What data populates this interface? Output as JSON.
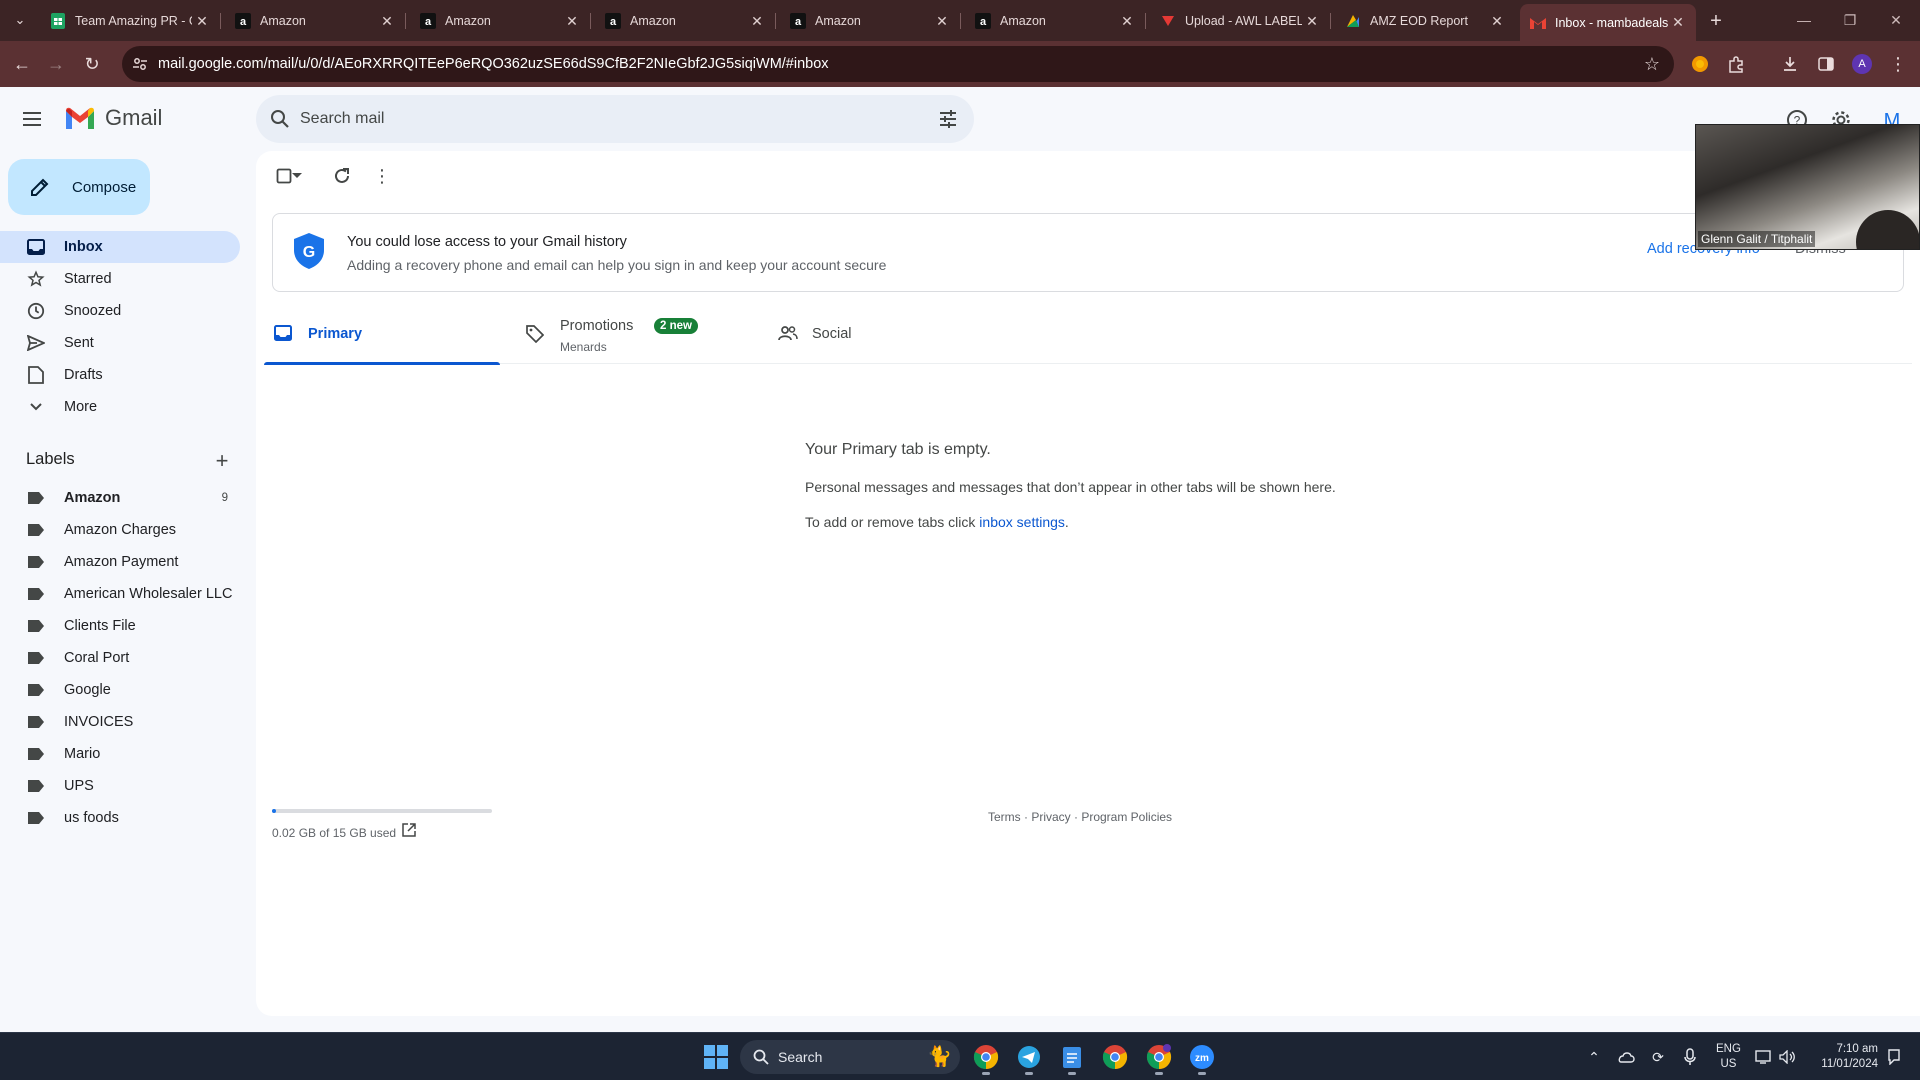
{
  "browser": {
    "tabs": [
      {
        "title": "Team Amazing PR - G",
        "favicon": "sheets-icon"
      },
      {
        "title": "Amazon",
        "favicon": "amazon-icon"
      },
      {
        "title": "Amazon",
        "favicon": "amazon-icon"
      },
      {
        "title": "Amazon",
        "favicon": "amazon-icon"
      },
      {
        "title": "Amazon",
        "favicon": "amazon-icon"
      },
      {
        "title": "Amazon",
        "favicon": "amazon-icon"
      },
      {
        "title": "Upload - AWL LABEL",
        "favicon": "upload-icon"
      },
      {
        "title": "AMZ EOD Report",
        "favicon": "report-icon"
      },
      {
        "title": "Inbox - mambadeals",
        "favicon": "gmail-icon"
      }
    ],
    "url": "mail.google.com/mail/u/0/d/AEoRXRRQITEeP6eRQO362uzSE66dS9CfB2F2NIeGbf2JG5siqiWM/#inbox",
    "profile_initial": "A"
  },
  "gmail": {
    "brand": "Gmail",
    "search_placeholder": "Search mail",
    "avatar_initial": "M",
    "compose_label": "Compose",
    "nav": [
      {
        "label": "Inbox",
        "icon": "inbox-icon",
        "active": true
      },
      {
        "label": "Starred",
        "icon": "star-icon"
      },
      {
        "label": "Snoozed",
        "icon": "clock-icon"
      },
      {
        "label": "Sent",
        "icon": "send-icon"
      },
      {
        "label": "Drafts",
        "icon": "draft-icon"
      },
      {
        "label": "More",
        "icon": "chevron-down-icon"
      }
    ],
    "labels_title": "Labels",
    "labels": [
      {
        "name": "Amazon",
        "count": "9",
        "bold": true
      },
      {
        "name": "Amazon Charges"
      },
      {
        "name": "Amazon Payment"
      },
      {
        "name": "American Wholesaler LLC"
      },
      {
        "name": "Clients File"
      },
      {
        "name": "Coral Port"
      },
      {
        "name": "Google"
      },
      {
        "name": "INVOICES"
      },
      {
        "name": "Mario"
      },
      {
        "name": "UPS"
      },
      {
        "name": "us foods"
      }
    ],
    "banner": {
      "title": "You could lose access to your Gmail history",
      "subtitle": "Adding a recovery phone and email can help you sign in and keep your account secure",
      "action": "Add recovery info",
      "dismiss": "Dismiss"
    },
    "tabs": [
      {
        "label": "Primary",
        "active": true
      },
      {
        "label": "Promotions",
        "badge": "2 new",
        "sub": "Menards"
      },
      {
        "label": "Social"
      }
    ],
    "empty_title": "Your Primary tab is empty.",
    "empty_line1": "Personal messages and messages that don’t appear in other tabs will be shown here.",
    "empty_line2_prefix": "To add or remove tabs click ",
    "empty_line2_link": "inbox settings",
    "empty_line2_suffix": ".",
    "storage_text": "0.02 GB of 15 GB used",
    "storage_fraction": 0.0013,
    "footer": "Terms · Privacy · Program Policies"
  },
  "video_overlay": {
    "name": "Glenn Galit / Titphalit"
  },
  "taskbar": {
    "search_label": "Search",
    "lang_top": "ENG",
    "lang_bottom": "US",
    "time": "7:10 am",
    "date": "11/01/2024"
  },
  "colors": {
    "chrome_bg": "#3c2425",
    "toolbar_bg": "#5b3133",
    "accent": "#0b57d0",
    "compose_bg": "#c2e7ff",
    "active_nav": "#d3e3fd",
    "badge_green": "#188038"
  }
}
